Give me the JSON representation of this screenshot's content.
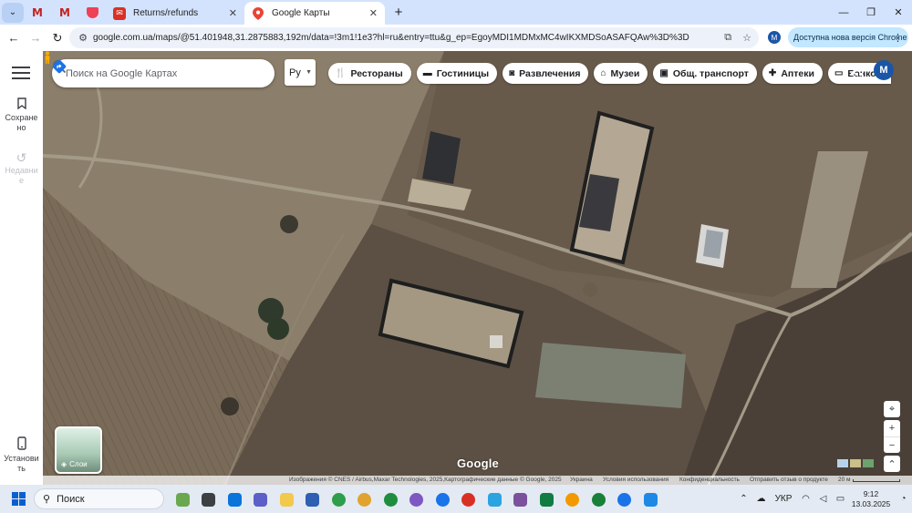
{
  "browser": {
    "pinned_tabs": [
      {
        "icon": "gmail-icon",
        "color": "#c5221f"
      },
      {
        "icon": "gmail-icon",
        "color": "#c5221f"
      },
      {
        "icon": "pocket-icon",
        "color": "#ef4056"
      }
    ],
    "tabs": [
      {
        "title": "Returns/refunds",
        "icon": "returns-site-icon",
        "active": false
      },
      {
        "title": "Google Карты",
        "icon": "google-maps-icon",
        "active": true
      }
    ],
    "url": "google.com.ua/maps/@51.401948,31.2875883,192m/data=!3m1!1e3?hl=ru&entry=ttu&g_ep=EgoyMDI1MDMxMC4wIKXMDSoASAFQAw%3D%3D",
    "profile_initial": "M",
    "update_button": "Доступна нова версія Chrome"
  },
  "maps": {
    "search_placeholder": "Поиск на Google Картах",
    "language": "Ру",
    "rail": [
      {
        "label": "Сохранено",
        "icon": "bookmark-icon"
      },
      {
        "label": "Недавние",
        "icon": "history-icon"
      }
    ],
    "install_label": "Установить",
    "categories": [
      {
        "label": "Рестораны",
        "icon": "restaurant-icon"
      },
      {
        "label": "Гостиницы",
        "icon": "hotel-icon"
      },
      {
        "label": "Развлечения",
        "icon": "camera-icon"
      },
      {
        "label": "Музеи",
        "icon": "museum-icon"
      },
      {
        "label": "Общ. транспорт",
        "icon": "transit-icon"
      },
      {
        "label": "Аптеки",
        "icon": "pharmacy-icon"
      },
      {
        "label": "Банкоматы",
        "icon": "atm-icon"
      }
    ],
    "avatar_initial": "M",
    "layers_label": "Слои",
    "logo": "Google",
    "attribution": {
      "imagery": "Изображения © CNES / Airbus,Maxar Technologies, 2025,Картографические данные © Google, 2025",
      "country": "Украина",
      "terms": "Условия использования",
      "privacy": "Конфиденциальность",
      "feedback": "Отправить отзыв о продукте",
      "scale": "20 м"
    }
  },
  "taskbar": {
    "search": "Поиск",
    "apps": [
      {
        "name": "widgets-icon",
        "color": "#6aa84f"
      },
      {
        "name": "file-stack-icon",
        "color": "#3c4043"
      },
      {
        "name": "windows-store-icon",
        "color": "#0a74da"
      },
      {
        "name": "teams-icon",
        "color": "#5b5fc7"
      },
      {
        "name": "file-explorer-icon",
        "color": "#f2c94c"
      },
      {
        "name": "calendar-app-icon",
        "color": "#2f5fb3"
      },
      {
        "name": "chrome-profile-icon",
        "color": "#2e9d4c"
      },
      {
        "name": "chrome-profile-icon",
        "color": "#e0a32e"
      },
      {
        "name": "chrome-profile-icon",
        "color": "#1e8e3e"
      },
      {
        "name": "chrome-profile-icon",
        "color": "#7e57c2"
      },
      {
        "name": "chrome-profile-icon",
        "color": "#1a73e8"
      },
      {
        "name": "chrome-profile-icon",
        "color": "#d93025"
      },
      {
        "name": "telegram-icon",
        "color": "#2aa3e0"
      },
      {
        "name": "viber-icon",
        "color": "#7b519d"
      },
      {
        "name": "excel-icon",
        "color": "#107c41"
      },
      {
        "name": "chrome-profile-icon",
        "color": "#f29900"
      },
      {
        "name": "chrome-profile-icon",
        "color": "#188038"
      },
      {
        "name": "chrome-active-icon",
        "color": "#1a73e8"
      },
      {
        "name": "photos-app-icon",
        "color": "#1e88e5"
      }
    ],
    "language": "УКР",
    "time": "9:12",
    "date": "13.03.2025"
  }
}
